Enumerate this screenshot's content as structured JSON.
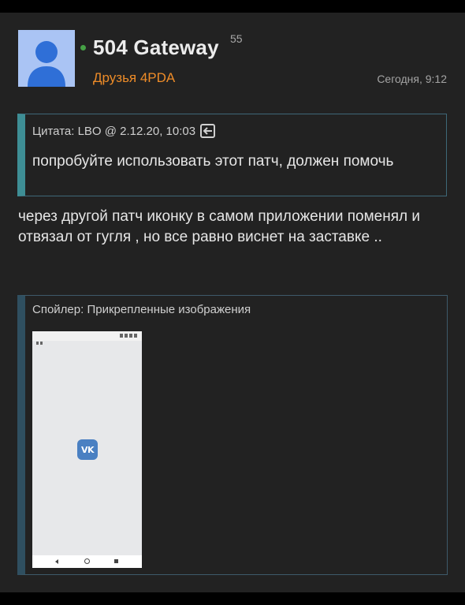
{
  "post": {
    "username": "504 Gateway",
    "reputation": "55",
    "group": "Друзья 4PDA",
    "time": "Сегодня, 9:12",
    "online": true
  },
  "quote": {
    "header": "Цитата: LBO @ 2.12.20, 10:03",
    "text": "попробуйте использовать этот патч, должен помочь",
    "link_icon": "go-to-source-icon"
  },
  "message": {
    "text": "через другой патч  иконку в самом приложении поменял и отвязал от гугля , но все равно виснет на заставке .."
  },
  "spoiler": {
    "title": "Спойлер: Прикрепленные изображения",
    "attachment_icon": "vk-logo-icon"
  },
  "colors": {
    "background": "#222222",
    "group": "#ee8c28",
    "online": "#46a146",
    "quote_border": "#3e8e95",
    "vk_blue": "#4a80c2"
  }
}
